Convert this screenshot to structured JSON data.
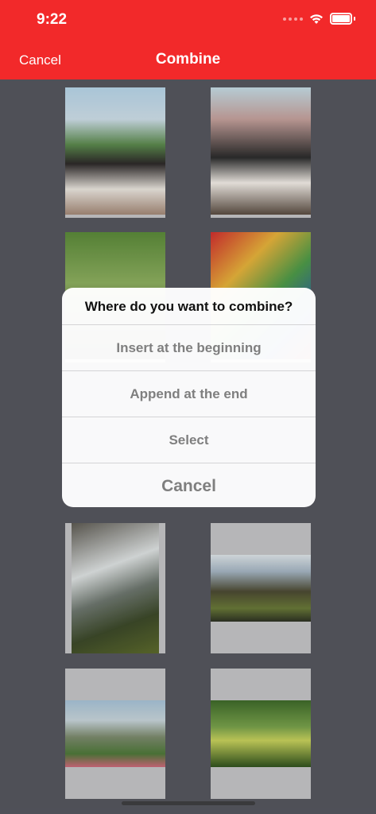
{
  "status_bar": {
    "time": "9:22"
  },
  "nav": {
    "cancel_label": "Cancel",
    "title": "Combine"
  },
  "photos": [
    "photo-1",
    "photo-2",
    "photo-3",
    "photo-4",
    "photo-5",
    "photo-6",
    "photo-7",
    "photo-8"
  ],
  "action_sheet": {
    "title": "Where do you want to combine?",
    "options": [
      "Insert at the beginning",
      "Append at the end",
      "Select"
    ],
    "cancel_label": "Cancel"
  },
  "colors": {
    "header": "#f2292a",
    "background": "#56575f",
    "option_text": "#7f7f7f"
  }
}
